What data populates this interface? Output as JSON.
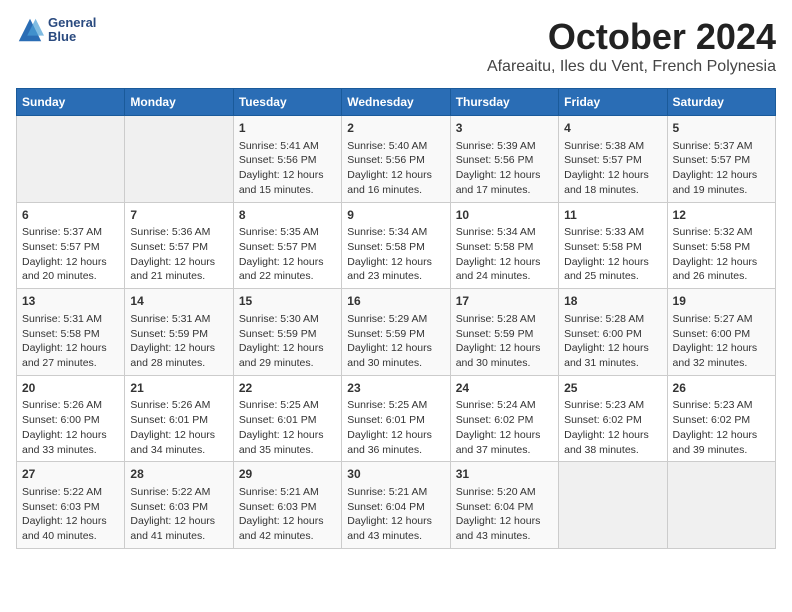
{
  "logo": {
    "line1": "General",
    "line2": "Blue"
  },
  "title": "October 2024",
  "location": "Afareaitu, Iles du Vent, French Polynesia",
  "headers": [
    "Sunday",
    "Monday",
    "Tuesday",
    "Wednesday",
    "Thursday",
    "Friday",
    "Saturday"
  ],
  "weeks": [
    [
      {
        "day": "",
        "info": ""
      },
      {
        "day": "",
        "info": ""
      },
      {
        "day": "1",
        "info": "Sunrise: 5:41 AM\nSunset: 5:56 PM\nDaylight: 12 hours and 15 minutes."
      },
      {
        "day": "2",
        "info": "Sunrise: 5:40 AM\nSunset: 5:56 PM\nDaylight: 12 hours and 16 minutes."
      },
      {
        "day": "3",
        "info": "Sunrise: 5:39 AM\nSunset: 5:56 PM\nDaylight: 12 hours and 17 minutes."
      },
      {
        "day": "4",
        "info": "Sunrise: 5:38 AM\nSunset: 5:57 PM\nDaylight: 12 hours and 18 minutes."
      },
      {
        "day": "5",
        "info": "Sunrise: 5:37 AM\nSunset: 5:57 PM\nDaylight: 12 hours and 19 minutes."
      }
    ],
    [
      {
        "day": "6",
        "info": "Sunrise: 5:37 AM\nSunset: 5:57 PM\nDaylight: 12 hours and 20 minutes."
      },
      {
        "day": "7",
        "info": "Sunrise: 5:36 AM\nSunset: 5:57 PM\nDaylight: 12 hours and 21 minutes."
      },
      {
        "day": "8",
        "info": "Sunrise: 5:35 AM\nSunset: 5:57 PM\nDaylight: 12 hours and 22 minutes."
      },
      {
        "day": "9",
        "info": "Sunrise: 5:34 AM\nSunset: 5:58 PM\nDaylight: 12 hours and 23 minutes."
      },
      {
        "day": "10",
        "info": "Sunrise: 5:34 AM\nSunset: 5:58 PM\nDaylight: 12 hours and 24 minutes."
      },
      {
        "day": "11",
        "info": "Sunrise: 5:33 AM\nSunset: 5:58 PM\nDaylight: 12 hours and 25 minutes."
      },
      {
        "day": "12",
        "info": "Sunrise: 5:32 AM\nSunset: 5:58 PM\nDaylight: 12 hours and 26 minutes."
      }
    ],
    [
      {
        "day": "13",
        "info": "Sunrise: 5:31 AM\nSunset: 5:58 PM\nDaylight: 12 hours and 27 minutes."
      },
      {
        "day": "14",
        "info": "Sunrise: 5:31 AM\nSunset: 5:59 PM\nDaylight: 12 hours and 28 minutes."
      },
      {
        "day": "15",
        "info": "Sunrise: 5:30 AM\nSunset: 5:59 PM\nDaylight: 12 hours and 29 minutes."
      },
      {
        "day": "16",
        "info": "Sunrise: 5:29 AM\nSunset: 5:59 PM\nDaylight: 12 hours and 30 minutes."
      },
      {
        "day": "17",
        "info": "Sunrise: 5:28 AM\nSunset: 5:59 PM\nDaylight: 12 hours and 30 minutes."
      },
      {
        "day": "18",
        "info": "Sunrise: 5:28 AM\nSunset: 6:00 PM\nDaylight: 12 hours and 31 minutes."
      },
      {
        "day": "19",
        "info": "Sunrise: 5:27 AM\nSunset: 6:00 PM\nDaylight: 12 hours and 32 minutes."
      }
    ],
    [
      {
        "day": "20",
        "info": "Sunrise: 5:26 AM\nSunset: 6:00 PM\nDaylight: 12 hours and 33 minutes."
      },
      {
        "day": "21",
        "info": "Sunrise: 5:26 AM\nSunset: 6:01 PM\nDaylight: 12 hours and 34 minutes."
      },
      {
        "day": "22",
        "info": "Sunrise: 5:25 AM\nSunset: 6:01 PM\nDaylight: 12 hours and 35 minutes."
      },
      {
        "day": "23",
        "info": "Sunrise: 5:25 AM\nSunset: 6:01 PM\nDaylight: 12 hours and 36 minutes."
      },
      {
        "day": "24",
        "info": "Sunrise: 5:24 AM\nSunset: 6:02 PM\nDaylight: 12 hours and 37 minutes."
      },
      {
        "day": "25",
        "info": "Sunrise: 5:23 AM\nSunset: 6:02 PM\nDaylight: 12 hours and 38 minutes."
      },
      {
        "day": "26",
        "info": "Sunrise: 5:23 AM\nSunset: 6:02 PM\nDaylight: 12 hours and 39 minutes."
      }
    ],
    [
      {
        "day": "27",
        "info": "Sunrise: 5:22 AM\nSunset: 6:03 PM\nDaylight: 12 hours and 40 minutes."
      },
      {
        "day": "28",
        "info": "Sunrise: 5:22 AM\nSunset: 6:03 PM\nDaylight: 12 hours and 41 minutes."
      },
      {
        "day": "29",
        "info": "Sunrise: 5:21 AM\nSunset: 6:03 PM\nDaylight: 12 hours and 42 minutes."
      },
      {
        "day": "30",
        "info": "Sunrise: 5:21 AM\nSunset: 6:04 PM\nDaylight: 12 hours and 43 minutes."
      },
      {
        "day": "31",
        "info": "Sunrise: 5:20 AM\nSunset: 6:04 PM\nDaylight: 12 hours and 43 minutes."
      },
      {
        "day": "",
        "info": ""
      },
      {
        "day": "",
        "info": ""
      }
    ]
  ]
}
